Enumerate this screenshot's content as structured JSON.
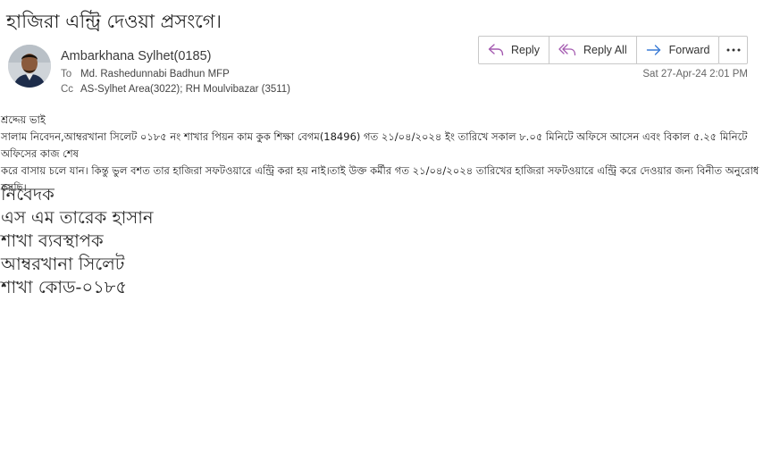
{
  "email": {
    "subject": "হাজিরা এন্ট্রি দেওয়া প্রসংগে।",
    "sender": "Ambarkhana Sylhet(0185)",
    "to_label": "To",
    "to": "Md. Rashedunnabi Badhun MFP",
    "cc_label": "Cc",
    "cc": "AS-Sylhet Area(3022); RH Moulvibazar (3511)",
    "date": "Sat 27-Apr-24 2:01 PM"
  },
  "actions": {
    "reply": "Reply",
    "reply_all": "Reply All",
    "forward": "Forward"
  },
  "body": {
    "salutation": "শ্রদ্দেয় ভাই",
    "line1": "সালাম নিবেদন,আম্বরখানা সিলেট ০১৮৫ নং শাখার পিয়ন কাম কুক শিক্ষা বেগম(18496) গত ২১/০৪/২০২৪ ইং তারিখে সকাল ৮.০৫ মিনিটে অফিসে আসেন এবং বিকাল ৫.২৫ মিনিটে অফিসের কাজ শেষ",
    "line2": "করে বাসায় চলে যান। কিন্তু ভুল বশত তার হাজিরা সফটওয়ারে এন্ট্রি করা হয় নাই।তাই উক্ত কর্মীর গত ২১/০৪/২০২৪ তারিখের হাজিরা সফটওয়ারে এন্ট্রি করে দেওয়ার জন্য বিনীত অনুরোধ করছি।"
  },
  "signature": {
    "line1": "নিবেদক",
    "line2": "এস এম তারেক হাসান",
    "line3": "শাখা ব্যবস্থাপক",
    "line4": "আম্বরখানা সিলেট",
    "line5": "শাখা কোড-০১৮৫"
  },
  "colors": {
    "reply_icon": "#a45ab0",
    "forward_icon": "#3a7bd5"
  },
  "icons": [
    "reply-icon",
    "reply-all-icon",
    "forward-icon",
    "more-icon",
    "avatar"
  ]
}
